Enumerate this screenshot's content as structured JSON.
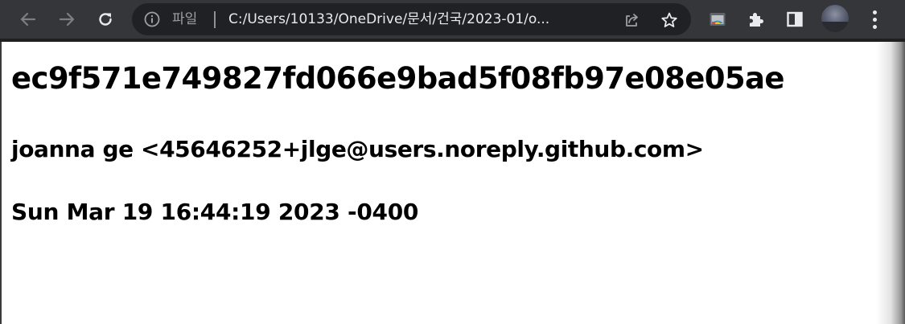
{
  "browser": {
    "address_bar": {
      "scheme_label": "파일",
      "url": "C:/Users/10133/OneDrive/문서/건국/2023-01/o..."
    },
    "icons": {
      "back": "arrow-left-icon",
      "forward": "arrow-right-icon",
      "reload": "reload-icon",
      "site_info": "info-icon",
      "share": "share-icon",
      "bookmark": "star-icon",
      "cast": "cast-icon",
      "extensions": "puzzle-icon",
      "side_panel": "side-panel-icon",
      "profile": "avatar",
      "menu": "menu-dots-icon"
    },
    "colors": {
      "toolbar_bg": "#35363a",
      "omnibox_bg": "#202124",
      "text_light": "#e8eaed",
      "text_dim": "#9aa0a6"
    }
  },
  "page": {
    "commit_hash": "ec9f571e749827fd066e9bad5f08fb97e08e05ae",
    "author": "joanna ge <45646252+jlge@users.noreply.github.com>",
    "date": "Sun Mar 19 16:44:19 2023 -0400"
  }
}
